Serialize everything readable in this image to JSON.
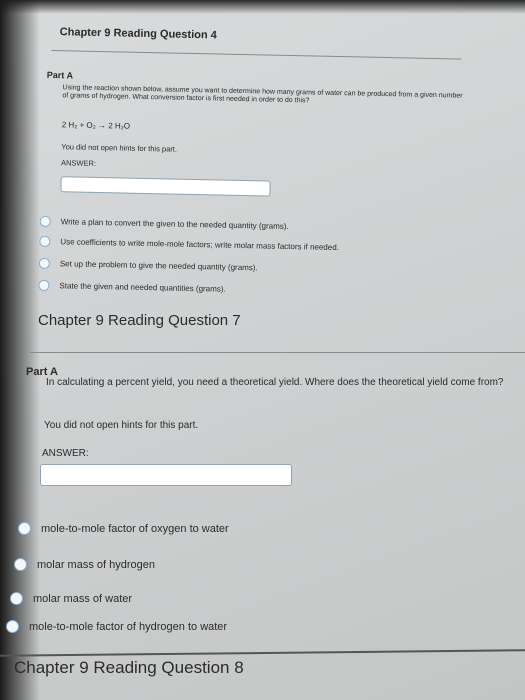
{
  "q4": {
    "title": "Chapter 9 Reading Question 4",
    "part": "Part A",
    "prompt": "Using the reaction shown below, assume you want to determine how many grams of water can be produced from a given number of grams of hydrogen. What conversion factor is first needed in order to do this?",
    "equation": "2 H₂ + O₂ → 2 H₂O",
    "hint": "You did not open hints for this part.",
    "answer_label": "ANSWER:",
    "options": [
      "Write a plan to convert the given to the needed quantity (grams).",
      "Use coefficients to write mole-mole factors; write molar mass factors if needed.",
      "Set up the problem to give the needed quantity (grams).",
      "State the given and needed quantities (grams)."
    ]
  },
  "q7": {
    "title": "Chapter 9 Reading Question 7",
    "part": "Part A",
    "prompt": "In calculating a percent yield, you need a theoretical yield. Where does the theoretical yield come from?",
    "hint": "You did not open hints for this part.",
    "answer_label": "ANSWER:",
    "options": [
      "mole-to-mole factor of oxygen to water",
      "molar mass of hydrogen",
      "molar mass of water",
      "mole-to-mole factor of hydrogen to water"
    ]
  },
  "q8": {
    "title": "Chapter 9 Reading Question 8"
  }
}
